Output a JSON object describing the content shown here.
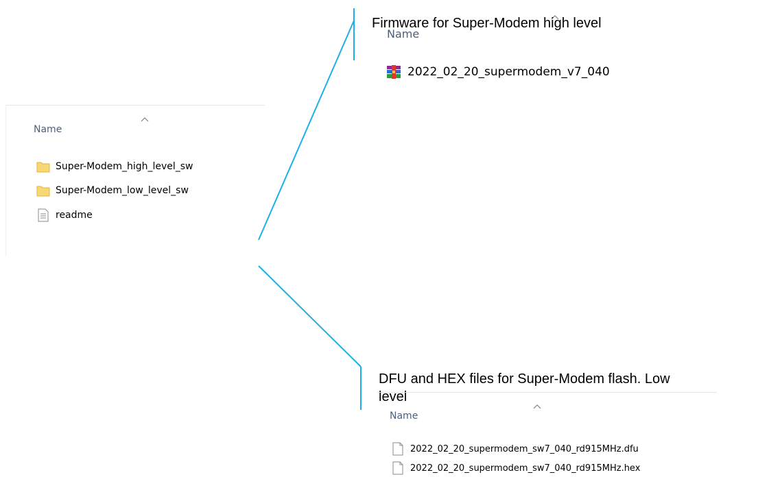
{
  "left_pane": {
    "column_header": "Name",
    "items": [
      {
        "label": "Super-Modem_high_level_sw",
        "icon": "folder-icon"
      },
      {
        "label": "Super-Modem_low_level_sw",
        "icon": "folder-icon"
      },
      {
        "label": "readme",
        "icon": "text-file-icon"
      }
    ]
  },
  "top_pane": {
    "annotation": "Firmware for Super-Modem high level",
    "column_header": "Name",
    "items": [
      {
        "label": "2022_02_20_supermodem_v7_040",
        "icon": "rar-archive-icon"
      }
    ]
  },
  "bottom_pane": {
    "annotation_line1": "DFU and HEX files for Super-Modem flash. Low",
    "annotation_line2": "level",
    "column_header": "Name",
    "items": [
      {
        "label": "2022_02_20_supermodem_sw7_040_rd915MHz.dfu",
        "icon": "file-icon"
      },
      {
        "label": "2022_02_20_supermodem_sw7_040_rd915MHz.hex",
        "icon": "file-icon"
      }
    ]
  },
  "colors": {
    "connector": "#1ab0e8",
    "header_text": "#4c607a",
    "folder": "#f8d775"
  }
}
